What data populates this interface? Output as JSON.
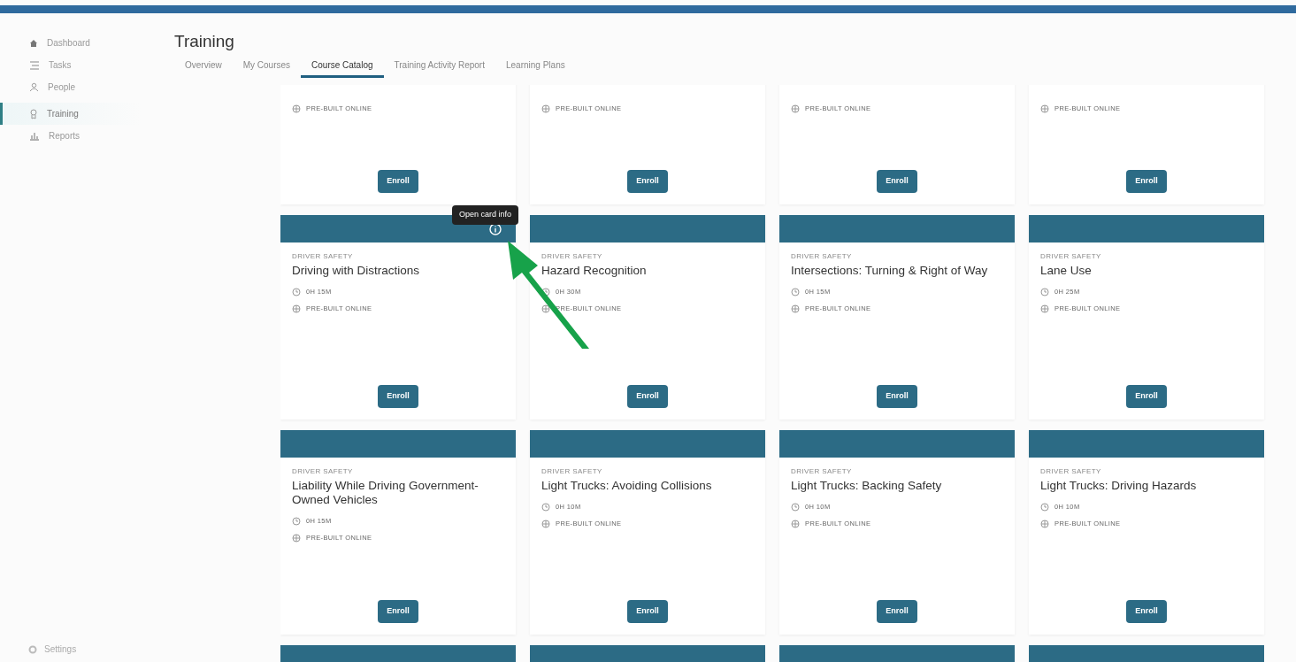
{
  "sidebar": {
    "items": [
      {
        "label": "Dashboard",
        "selected": false
      },
      {
        "label": "Tasks",
        "selected": false
      },
      {
        "label": "People",
        "selected": false
      },
      {
        "label": "Training",
        "selected": true
      },
      {
        "label": "Reports",
        "selected": false
      }
    ],
    "footer": {
      "label": "Settings"
    }
  },
  "page": {
    "title": "Training"
  },
  "tabs": [
    {
      "label": "Overview",
      "selected": false
    },
    {
      "label": "My Courses",
      "selected": false
    },
    {
      "label": "Course Catalog",
      "selected": true
    },
    {
      "label": "Training Activity Report",
      "selected": false
    },
    {
      "label": "Learning Plans",
      "selected": false
    }
  ],
  "cards": [
    {
      "kind": "clipped_course",
      "modality": "PRE-BUILT ONLINE",
      "button": "Enroll"
    },
    {
      "kind": "clipped_course",
      "modality": "PRE-BUILT ONLINE",
      "button": "Enroll"
    },
    {
      "kind": "clipped_course",
      "modality": "PRE-BUILT ONLINE",
      "button": "Enroll"
    },
    {
      "kind": "clipped_course",
      "modality": "PRE-BUILT ONLINE",
      "button": "Enroll"
    },
    {
      "kind": "course",
      "category": "DRIVER SAFETY",
      "title": "Driving with Distractions",
      "duration": "0H 15M",
      "modality": "PRE-BUILT ONLINE",
      "button": "Enroll",
      "tooltip": "Open card info"
    },
    {
      "kind": "course",
      "category": "DRIVER SAFETY",
      "title": "Hazard Recognition",
      "duration": "0H 30M",
      "modality": "PRE-BUILT ONLINE",
      "button": "Enroll"
    },
    {
      "kind": "course",
      "category": "DRIVER SAFETY",
      "title": "Intersections: Turning & Right of Way",
      "duration": "0H 15M",
      "modality": "PRE-BUILT ONLINE",
      "button": "Enroll"
    },
    {
      "kind": "course",
      "category": "DRIVER SAFETY",
      "title": "Lane Use",
      "duration": "0H 25M",
      "modality": "PRE-BUILT ONLINE",
      "button": "Enroll"
    },
    {
      "kind": "course",
      "category": "DRIVER SAFETY",
      "title": "Liability While Driving Government-Owned Vehicles",
      "duration": "0H 15M",
      "modality": "PRE-BUILT ONLINE",
      "button": "Enroll"
    },
    {
      "kind": "course",
      "category": "DRIVER SAFETY",
      "title": "Light Trucks: Avoiding Collisions",
      "duration": "0H 10M",
      "modality": "PRE-BUILT ONLINE",
      "button": "Enroll"
    },
    {
      "kind": "course",
      "category": "DRIVER SAFETY",
      "title": "Light Trucks: Backing Safety",
      "duration": "0H 10M",
      "modality": "PRE-BUILT ONLINE",
      "button": "Enroll"
    },
    {
      "kind": "course",
      "category": "DRIVER SAFETY",
      "title": "Light Trucks: Driving Hazards",
      "duration": "0H 10M",
      "modality": "PRE-BUILT ONLINE",
      "button": "Enroll"
    },
    {
      "kind": "header_only"
    },
    {
      "kind": "header_only"
    },
    {
      "kind": "header_only"
    },
    {
      "kind": "header_only"
    }
  ]
}
